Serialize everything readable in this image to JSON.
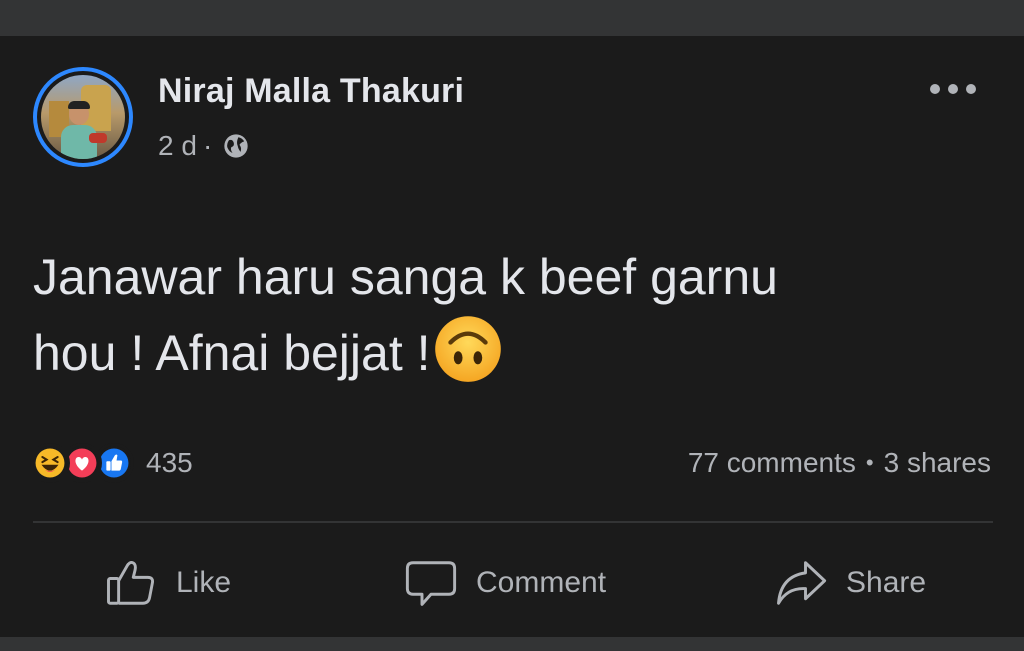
{
  "post": {
    "author": "Niraj Malla Thakuri",
    "time": "2 d",
    "separator": "·",
    "text_line1": "Janawar haru sanga k beef garnu",
    "text_line2": "hou ! Afnai bejjat !"
  },
  "engagement": {
    "reaction_count": "435",
    "comments": "77 comments",
    "dot": "•",
    "shares": "3 shares"
  },
  "actions": {
    "like": "Like",
    "comment": "Comment",
    "share": "Share"
  },
  "icons": {
    "visibility": "globe-icon",
    "more": "more-options-icon",
    "reactions": [
      "haha-icon",
      "love-icon",
      "like-icon"
    ],
    "emoji": "upside-down-face-emoji"
  },
  "colors": {
    "background": "#1b1b1b",
    "text": "#e4e6eb",
    "secondary_text": "#b0b3b8",
    "avatar_ring": "#2d88ff",
    "like_blue": "#1877f2",
    "love_red": "#f33e58",
    "haha_yellow": "#f7b928"
  }
}
